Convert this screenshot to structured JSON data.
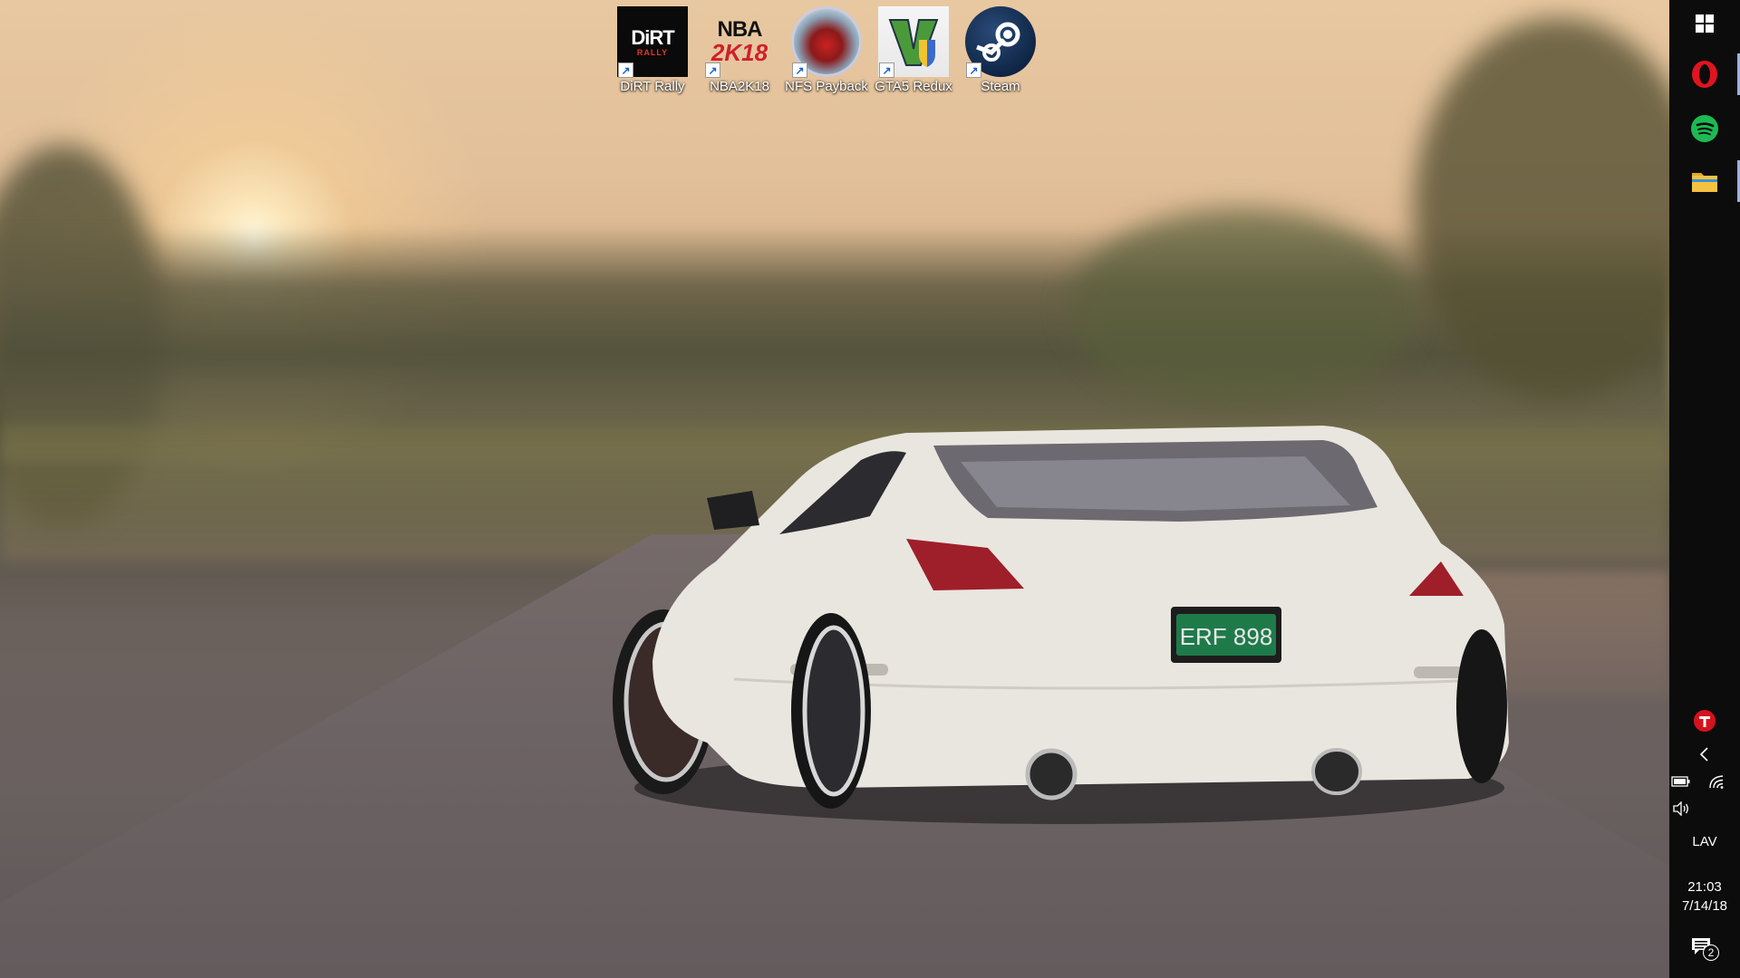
{
  "desktop": {
    "icons": [
      {
        "label": "DiRT Rally",
        "icon": "dirt-rally-icon",
        "line1": "DiRT",
        "line2": "RALLY"
      },
      {
        "label": "NBA2K18",
        "icon": "nba2k18-icon",
        "line1": "NBA",
        "line2": "2K18"
      },
      {
        "label": "NFS Payback",
        "icon": "nfs-payback-icon"
      },
      {
        "label": "GTA5 Redux",
        "icon": "gta5-redux-icon"
      },
      {
        "label": "Steam",
        "icon": "steam-icon"
      }
    ],
    "wallpaper": {
      "plate": "ERF 898"
    }
  },
  "taskbar": {
    "position": "right",
    "pinned": [
      {
        "name": "start",
        "icon": "windows-logo-icon"
      },
      {
        "name": "opera",
        "icon": "opera-icon",
        "active": true
      },
      {
        "name": "spotify",
        "icon": "spotify-icon"
      },
      {
        "name": "file-explorer",
        "icon": "folder-icon",
        "active": true
      }
    ],
    "tray": {
      "app_icon": "red-tray-app-icon",
      "show_hidden": "chevron-left-icon",
      "icons": [
        "battery-icon",
        "wifi-icon",
        "speaker-icon"
      ],
      "language": "LAV",
      "time": "21:03",
      "date": "7/14/18",
      "notifications_count": "2"
    }
  },
  "colors": {
    "taskbar_bg": "#0c0c0c",
    "opera_red": "#e0141e",
    "spotify_green": "#1db954",
    "folder_yellow": "#f3c240"
  }
}
